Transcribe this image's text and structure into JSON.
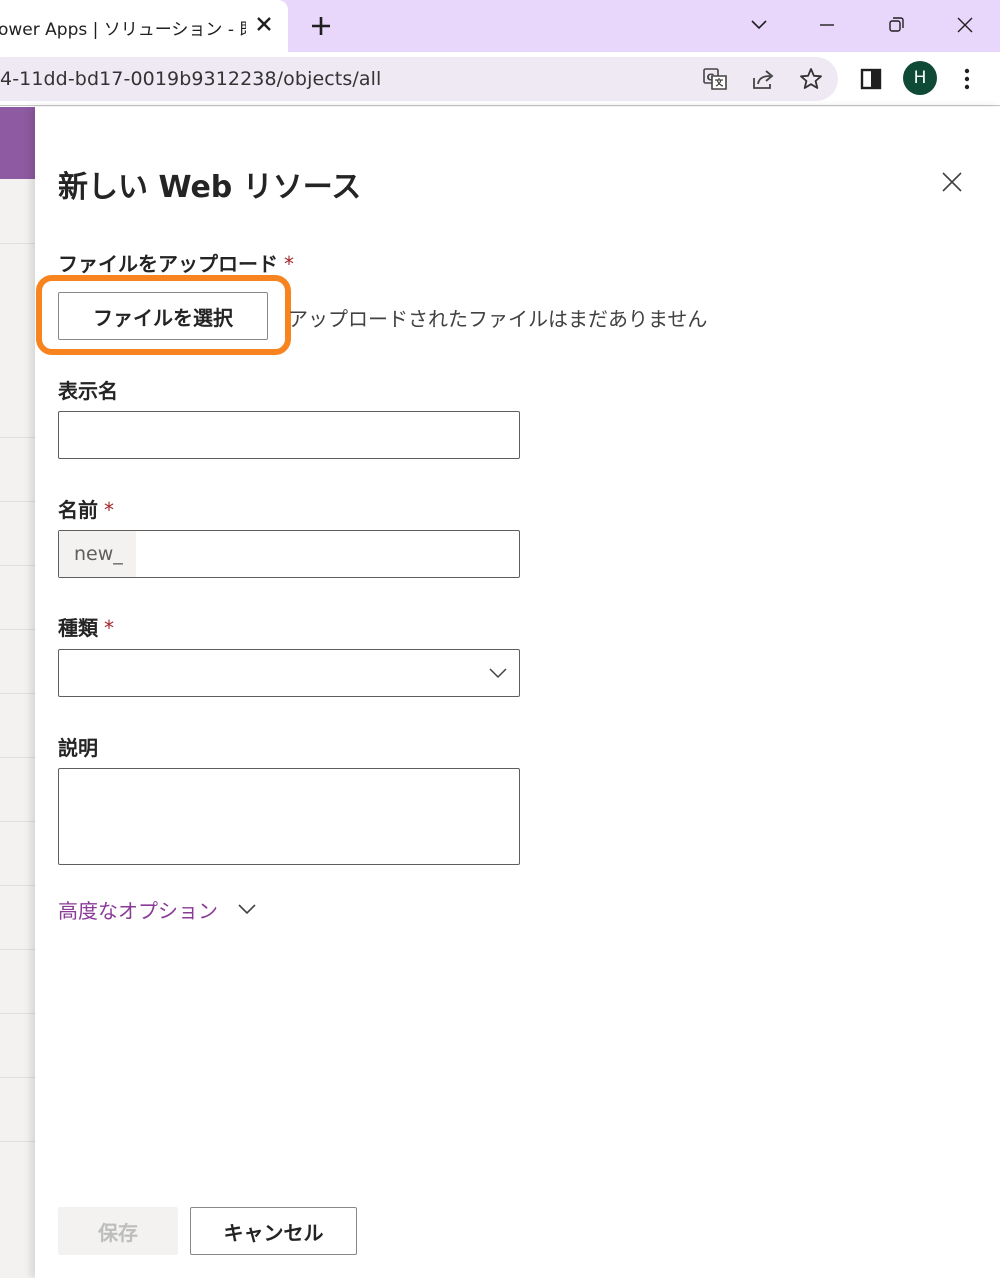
{
  "browser": {
    "tab_title": "ower Apps | ソリューション - 既定の",
    "url": "4-11dd-bd17-0019b9312238/objects/all",
    "profile_initial": "H"
  },
  "panel": {
    "title": "新しい Web リソース",
    "upload": {
      "label": "ファイルをアップロード",
      "required_mark": "*",
      "button_label": "ファイルを選択",
      "status_text": "アップロードされたファイルはまだありません",
      "highlight_color": "#f7841f"
    },
    "display_name": {
      "label": "表示名",
      "value": ""
    },
    "name": {
      "label": "名前",
      "required_mark": "*",
      "prefix": "new_",
      "value": ""
    },
    "type": {
      "label": "種類",
      "required_mark": "*",
      "selected": ""
    },
    "description": {
      "label": "説明",
      "value": ""
    },
    "advanced_options_label": "高度なオプション",
    "save_label": "保存",
    "cancel_label": "キャンセル"
  },
  "colors": {
    "accent": "#8a3b97",
    "required": "#a4262c",
    "titlebar": "#e9d7fb"
  },
  "icons": [
    "close-icon",
    "new-tab-icon",
    "chevron-down-icon",
    "minimize-icon",
    "restore-icon",
    "translate-icon",
    "share-icon",
    "star-icon",
    "side-panel-icon",
    "more-icon"
  ]
}
